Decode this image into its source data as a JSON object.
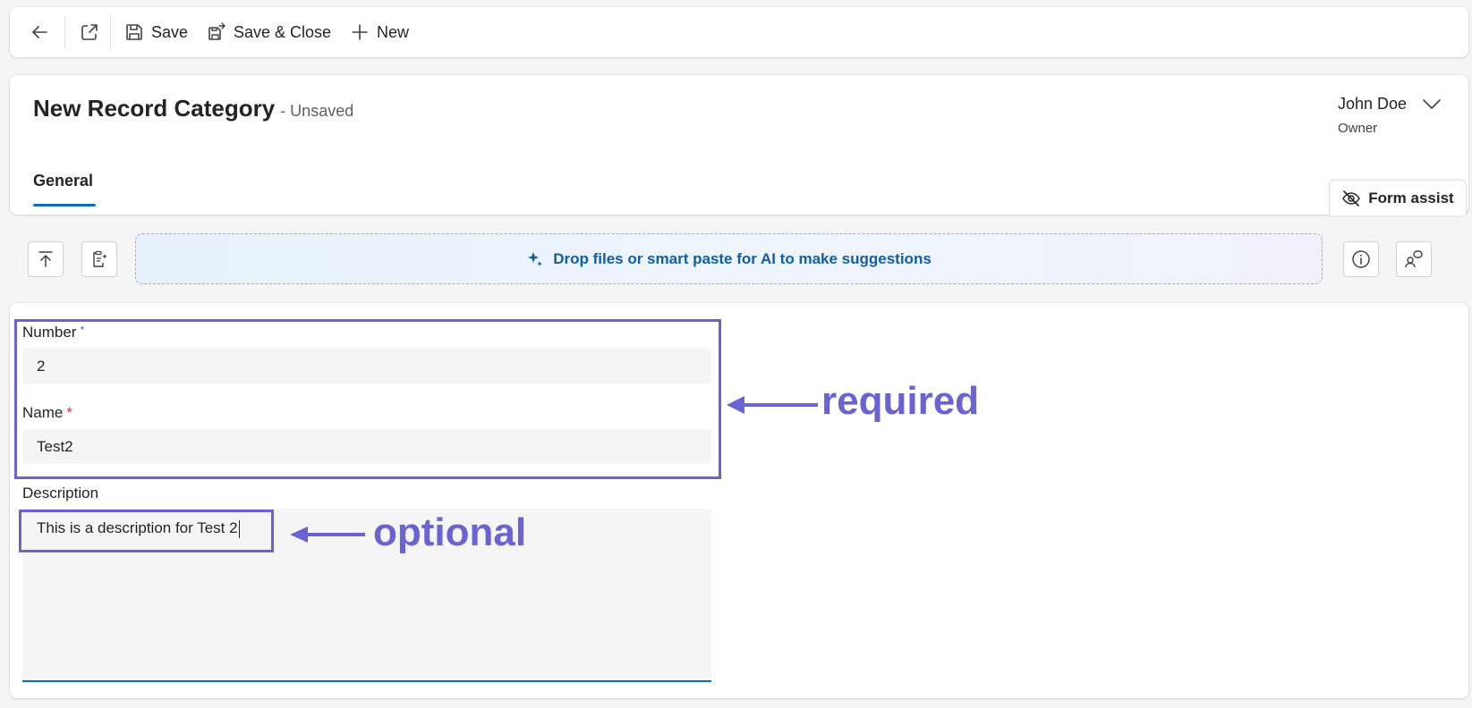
{
  "toolbar": {
    "back_icon": "arrow-left-icon",
    "popout_icon": "open-in-new-window-icon",
    "save_label": "Save",
    "save_close_label": "Save & Close",
    "new_label": "New"
  },
  "header": {
    "title": "New Record Category",
    "status": "- Unsaved",
    "owner_name": "John Doe",
    "owner_label": "Owner",
    "tabs": [
      {
        "label": "General"
      }
    ],
    "form_assist_label": "Form assist"
  },
  "assist": {
    "dropzone_text": "Drop files or smart paste for AI to make suggestions"
  },
  "form": {
    "number": {
      "label": "Number",
      "required_mark": "*",
      "value": "2"
    },
    "name": {
      "label": "Name",
      "required_mark": "*",
      "value": "Test2"
    },
    "description": {
      "label": "Description",
      "value": "This is a description for Test 2"
    }
  },
  "annotations": {
    "required_label": "required",
    "optional_label": "optional",
    "color": "#6a63d4"
  },
  "colors": {
    "accent": "#0f6cbd",
    "required_red": "#c4314b",
    "annotation": "#6a63d4"
  }
}
